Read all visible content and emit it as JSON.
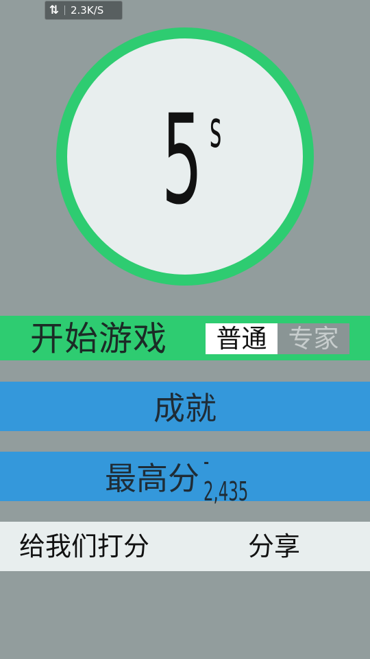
{
  "status_bar": {
    "network_icon": "up-down-arrows-icon",
    "network_speed": "2.3K/S"
  },
  "timer": {
    "value": "5",
    "unit": "s",
    "ring_color": "#2ecc71"
  },
  "start": {
    "label": "开始游戏",
    "mode_normal": "普通",
    "mode_expert": "专家",
    "selected_mode": "普通"
  },
  "achievements": {
    "label": "成就"
  },
  "best_score": {
    "label": "最高分",
    "value": "- 2,435"
  },
  "footer": {
    "rate_label": "给我们打分",
    "share_label": "分享"
  },
  "colors": {
    "background": "#929d9d",
    "green": "#2ecc71",
    "blue": "#3498db",
    "light": "#e8eeee"
  }
}
